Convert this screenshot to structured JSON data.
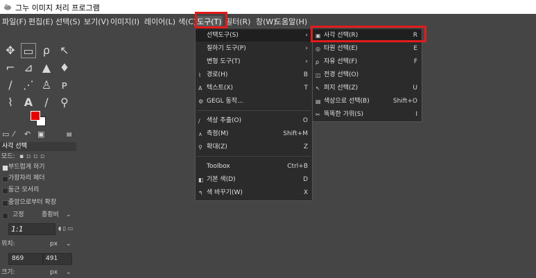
{
  "window": {
    "title": "그누 이미지 처리 프로그램"
  },
  "menubar": [
    "파일(F)",
    "편집(E)",
    "선택(S)",
    "보기(V)",
    "이미지(I)",
    "레이어(L)",
    "색(C)",
    "도구(T)",
    "필터(R)",
    "창(W)",
    "도움말(H)"
  ],
  "active_menu": "도구(T)",
  "tools_menu": {
    "items": [
      {
        "label": "선택도구(S)",
        "shortcut": "",
        "submenu": true,
        "icon": ""
      },
      {
        "label": "칠하기 도구(P)",
        "shortcut": "",
        "submenu": true,
        "icon": ""
      },
      {
        "label": "변형 도구(T)",
        "shortcut": "",
        "submenu": true,
        "icon": ""
      },
      {
        "label": "경로(H)",
        "shortcut": "B",
        "submenu": false,
        "icon": "path-icon"
      },
      {
        "label": "텍스트(X)",
        "shortcut": "T",
        "submenu": false,
        "icon": "text-icon"
      },
      {
        "label": "GEGL 동작...",
        "shortcut": "",
        "submenu": false,
        "icon": "gegl-icon"
      },
      {
        "label": "색상 추출(O)",
        "shortcut": "O",
        "submenu": false,
        "icon": "color-picker-icon"
      },
      {
        "label": "측정(M)",
        "shortcut": "Shift+M",
        "submenu": false,
        "icon": "measure-icon"
      },
      {
        "label": "확대(Z)",
        "shortcut": "Z",
        "submenu": false,
        "icon": "zoom-icon"
      },
      {
        "label": "Toolbox",
        "shortcut": "Ctrl+B",
        "submenu": false,
        "icon": ""
      },
      {
        "label": "기본 색(D)",
        "shortcut": "D",
        "submenu": false,
        "icon": "default-colors-icon"
      },
      {
        "label": "색 바꾸기(W)",
        "shortcut": "X",
        "submenu": false,
        "icon": "swap-colors-icon"
      }
    ]
  },
  "selection_submenu": {
    "items": [
      {
        "label": "사각 선택(R)",
        "shortcut": "R",
        "icon": "rect-select-icon"
      },
      {
        "label": "타원 선택(E)",
        "shortcut": "E",
        "icon": "ellipse-select-icon"
      },
      {
        "label": "자유 선택(F)",
        "shortcut": "F",
        "icon": "free-select-icon"
      },
      {
        "label": "전경 선택(O)",
        "shortcut": "",
        "icon": "foreground-select-icon"
      },
      {
        "label": "퍼지 선택(Z)",
        "shortcut": "U",
        "icon": "fuzzy-select-icon"
      },
      {
        "label": "색상으로 선택(B)",
        "shortcut": "Shift+O",
        "icon": "select-by-color-icon"
      },
      {
        "label": "똑똑한 가위(S)",
        "shortcut": "I",
        "icon": "scissors-icon"
      }
    ]
  },
  "tool_options": {
    "title": "사각 선택",
    "mode_label": "모드:",
    "options": [
      "부드럽게 하기",
      "가장자리 페더",
      "둥근 모서리",
      "중앙으로부터 확장"
    ],
    "fixed_label": "고정",
    "fixed_value": "종횡비",
    "ratio_value": "1:1",
    "position_label": "위치:",
    "position_unit": "px",
    "pos_x": "869",
    "pos_y": "491",
    "size_label": "크기:",
    "size_unit": "px"
  },
  "colors": {
    "accent_red": "#e41b1b",
    "foreground": "#e60000",
    "background": "#ffffff"
  }
}
